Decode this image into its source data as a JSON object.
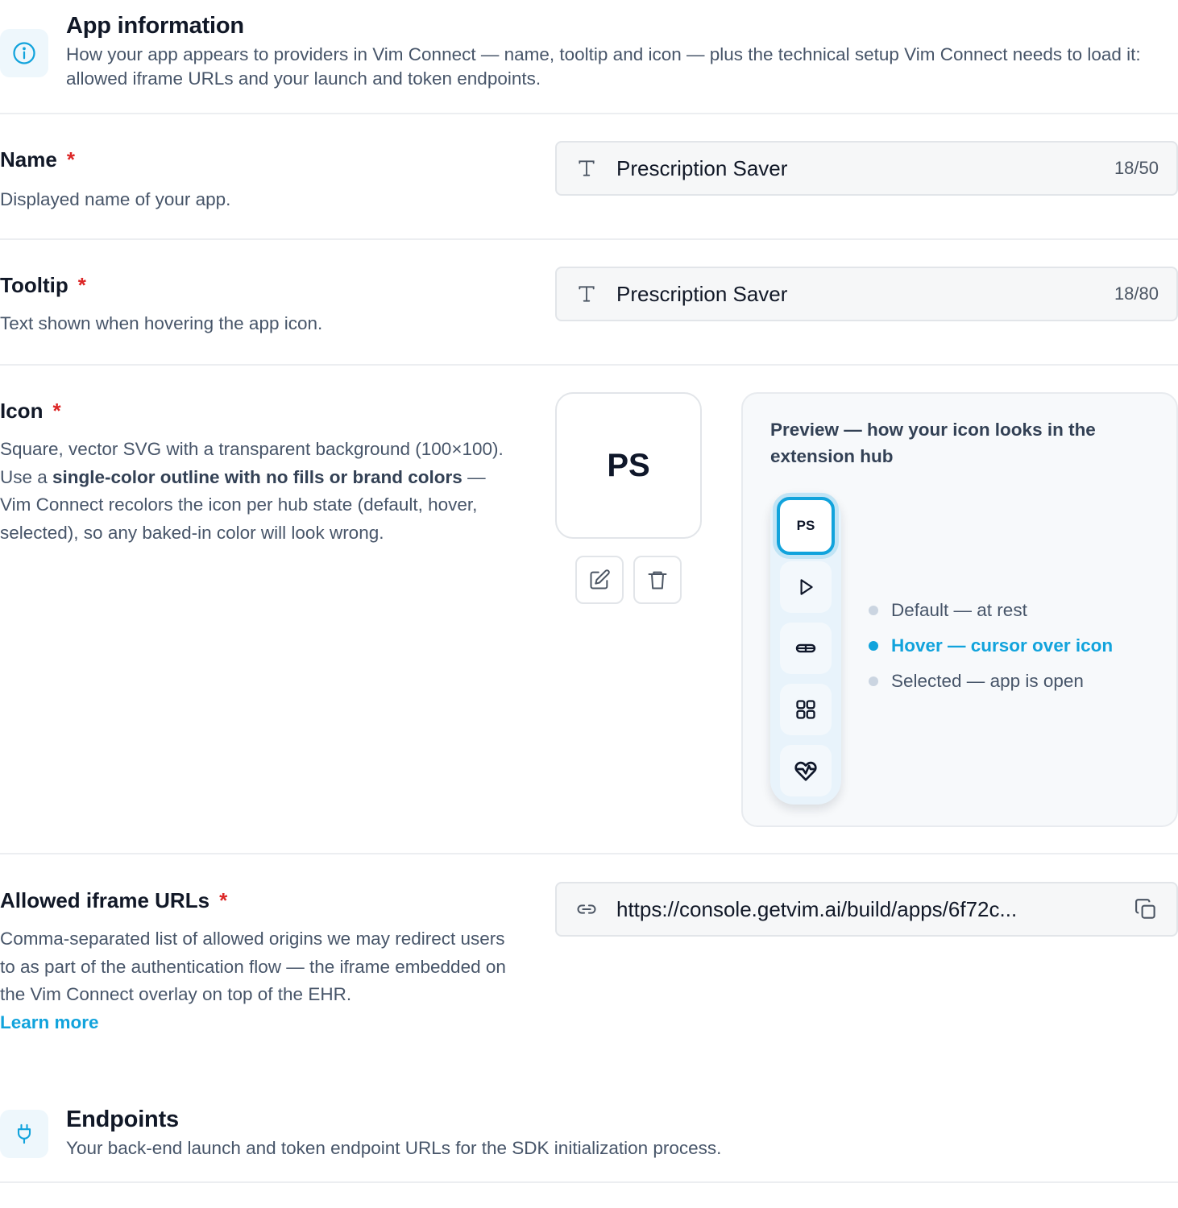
{
  "app_info": {
    "title": "App information",
    "description": "How your app appears to providers in Vim Connect — name, tooltip and icon — plus the technical setup Vim Connect needs to load it: allowed iframe URLs and your launch and token endpoints.",
    "icon": "info-circle-icon"
  },
  "fields": {
    "name": {
      "label": "Name",
      "required_mark": "*",
      "help": "Displayed name of your app.",
      "value": "Prescription Saver",
      "counter": "18/50",
      "icon": "text-type-icon"
    },
    "tooltip": {
      "label": "Tooltip",
      "required_mark": "*",
      "help": "Text shown when hovering the app icon.",
      "value": "Prescription Saver",
      "counter": "18/80",
      "icon": "text-type-icon"
    },
    "icon": {
      "label": "Icon",
      "required_mark": "*",
      "help_part1": "Square, vector SVG with a transparent background (100×100). Use a ",
      "help_bold": "single-color outline with no fills or brand colors",
      "help_part2": " — Vim Connect recolors the icon per hub state (default, hover, selected), so any baked-in color will look wrong.",
      "icon_text": "PS",
      "edit_icon": "pencil-edit-icon",
      "delete_icon": "trash-icon"
    },
    "iframe_urls": {
      "label": "Allowed iframe URLs",
      "required_mark": "*",
      "help": "Comma-separated list of allowed origins we may redirect users to as part of the authentication flow — the iframe embedded on the Vim Connect overlay on top of the EHR.",
      "learn_more": "Learn more",
      "value": "https://console.getvim.ai/build/apps/6f72c...",
      "icon": "link-icon",
      "copy_icon": "copy-icon"
    }
  },
  "preview": {
    "title": "Preview — how your icon looks in the extension hub",
    "hub_selected_text": "PS",
    "hub_icons": [
      "play-icon",
      "pill-icon",
      "grid-icon",
      "heart-icon"
    ],
    "states": [
      {
        "label": "Default — at rest",
        "active": false
      },
      {
        "label": "Hover — cursor over icon",
        "active": true
      },
      {
        "label": "Selected — app is open",
        "active": false
      }
    ],
    "colors": {
      "accent": "#11a3dc",
      "inactive_dot": "#cbd5e1"
    }
  },
  "endpoints": {
    "title": "Endpoints",
    "description": "Your back-end launch and token endpoint URLs for the SDK initialization process.",
    "icon": "plug-icon"
  }
}
